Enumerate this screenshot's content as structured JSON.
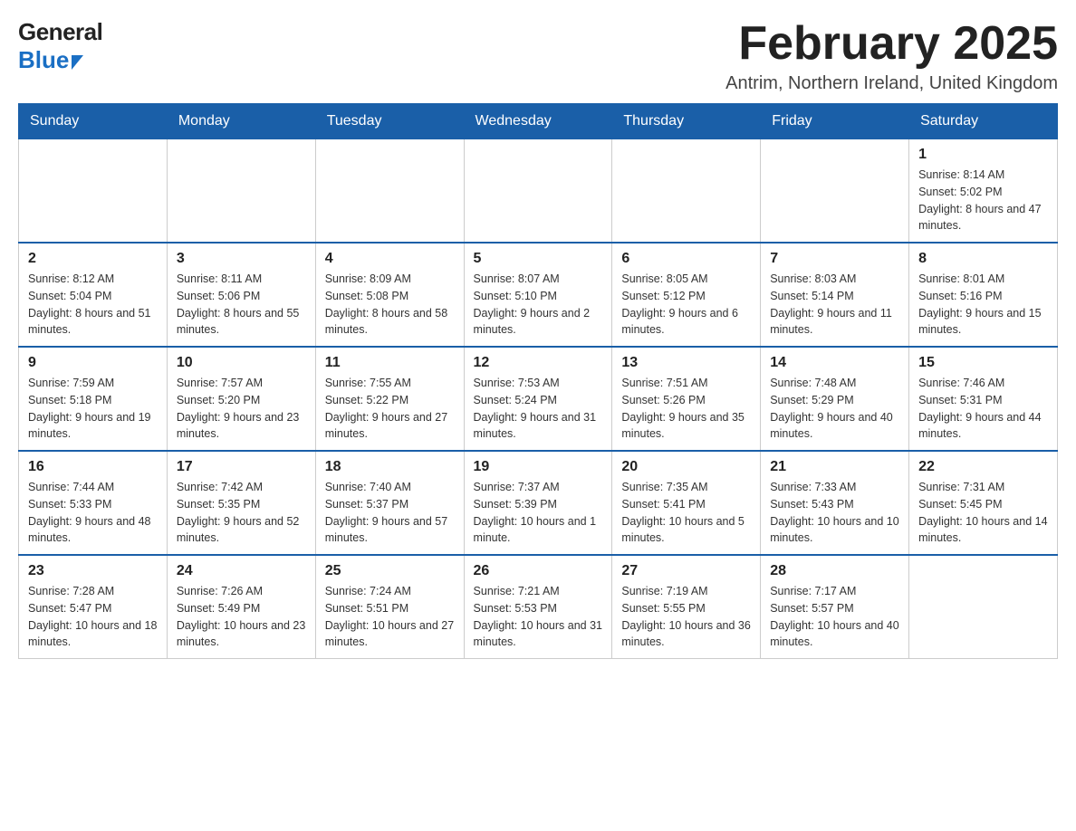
{
  "header": {
    "logo_general": "General",
    "logo_blue": "Blue",
    "month_title": "February 2025",
    "location": "Antrim, Northern Ireland, United Kingdom"
  },
  "weekdays": [
    "Sunday",
    "Monday",
    "Tuesday",
    "Wednesday",
    "Thursday",
    "Friday",
    "Saturday"
  ],
  "weeks": [
    [
      {
        "day": "",
        "info": ""
      },
      {
        "day": "",
        "info": ""
      },
      {
        "day": "",
        "info": ""
      },
      {
        "day": "",
        "info": ""
      },
      {
        "day": "",
        "info": ""
      },
      {
        "day": "",
        "info": ""
      },
      {
        "day": "1",
        "info": "Sunrise: 8:14 AM\nSunset: 5:02 PM\nDaylight: 8 hours and 47 minutes."
      }
    ],
    [
      {
        "day": "2",
        "info": "Sunrise: 8:12 AM\nSunset: 5:04 PM\nDaylight: 8 hours and 51 minutes."
      },
      {
        "day": "3",
        "info": "Sunrise: 8:11 AM\nSunset: 5:06 PM\nDaylight: 8 hours and 55 minutes."
      },
      {
        "day": "4",
        "info": "Sunrise: 8:09 AM\nSunset: 5:08 PM\nDaylight: 8 hours and 58 minutes."
      },
      {
        "day": "5",
        "info": "Sunrise: 8:07 AM\nSunset: 5:10 PM\nDaylight: 9 hours and 2 minutes."
      },
      {
        "day": "6",
        "info": "Sunrise: 8:05 AM\nSunset: 5:12 PM\nDaylight: 9 hours and 6 minutes."
      },
      {
        "day": "7",
        "info": "Sunrise: 8:03 AM\nSunset: 5:14 PM\nDaylight: 9 hours and 11 minutes."
      },
      {
        "day": "8",
        "info": "Sunrise: 8:01 AM\nSunset: 5:16 PM\nDaylight: 9 hours and 15 minutes."
      }
    ],
    [
      {
        "day": "9",
        "info": "Sunrise: 7:59 AM\nSunset: 5:18 PM\nDaylight: 9 hours and 19 minutes."
      },
      {
        "day": "10",
        "info": "Sunrise: 7:57 AM\nSunset: 5:20 PM\nDaylight: 9 hours and 23 minutes."
      },
      {
        "day": "11",
        "info": "Sunrise: 7:55 AM\nSunset: 5:22 PM\nDaylight: 9 hours and 27 minutes."
      },
      {
        "day": "12",
        "info": "Sunrise: 7:53 AM\nSunset: 5:24 PM\nDaylight: 9 hours and 31 minutes."
      },
      {
        "day": "13",
        "info": "Sunrise: 7:51 AM\nSunset: 5:26 PM\nDaylight: 9 hours and 35 minutes."
      },
      {
        "day": "14",
        "info": "Sunrise: 7:48 AM\nSunset: 5:29 PM\nDaylight: 9 hours and 40 minutes."
      },
      {
        "day": "15",
        "info": "Sunrise: 7:46 AM\nSunset: 5:31 PM\nDaylight: 9 hours and 44 minutes."
      }
    ],
    [
      {
        "day": "16",
        "info": "Sunrise: 7:44 AM\nSunset: 5:33 PM\nDaylight: 9 hours and 48 minutes."
      },
      {
        "day": "17",
        "info": "Sunrise: 7:42 AM\nSunset: 5:35 PM\nDaylight: 9 hours and 52 minutes."
      },
      {
        "day": "18",
        "info": "Sunrise: 7:40 AM\nSunset: 5:37 PM\nDaylight: 9 hours and 57 minutes."
      },
      {
        "day": "19",
        "info": "Sunrise: 7:37 AM\nSunset: 5:39 PM\nDaylight: 10 hours and 1 minute."
      },
      {
        "day": "20",
        "info": "Sunrise: 7:35 AM\nSunset: 5:41 PM\nDaylight: 10 hours and 5 minutes."
      },
      {
        "day": "21",
        "info": "Sunrise: 7:33 AM\nSunset: 5:43 PM\nDaylight: 10 hours and 10 minutes."
      },
      {
        "day": "22",
        "info": "Sunrise: 7:31 AM\nSunset: 5:45 PM\nDaylight: 10 hours and 14 minutes."
      }
    ],
    [
      {
        "day": "23",
        "info": "Sunrise: 7:28 AM\nSunset: 5:47 PM\nDaylight: 10 hours and 18 minutes."
      },
      {
        "day": "24",
        "info": "Sunrise: 7:26 AM\nSunset: 5:49 PM\nDaylight: 10 hours and 23 minutes."
      },
      {
        "day": "25",
        "info": "Sunrise: 7:24 AM\nSunset: 5:51 PM\nDaylight: 10 hours and 27 minutes."
      },
      {
        "day": "26",
        "info": "Sunrise: 7:21 AM\nSunset: 5:53 PM\nDaylight: 10 hours and 31 minutes."
      },
      {
        "day": "27",
        "info": "Sunrise: 7:19 AM\nSunset: 5:55 PM\nDaylight: 10 hours and 36 minutes."
      },
      {
        "day": "28",
        "info": "Sunrise: 7:17 AM\nSunset: 5:57 PM\nDaylight: 10 hours and 40 minutes."
      },
      {
        "day": "",
        "info": ""
      }
    ]
  ]
}
